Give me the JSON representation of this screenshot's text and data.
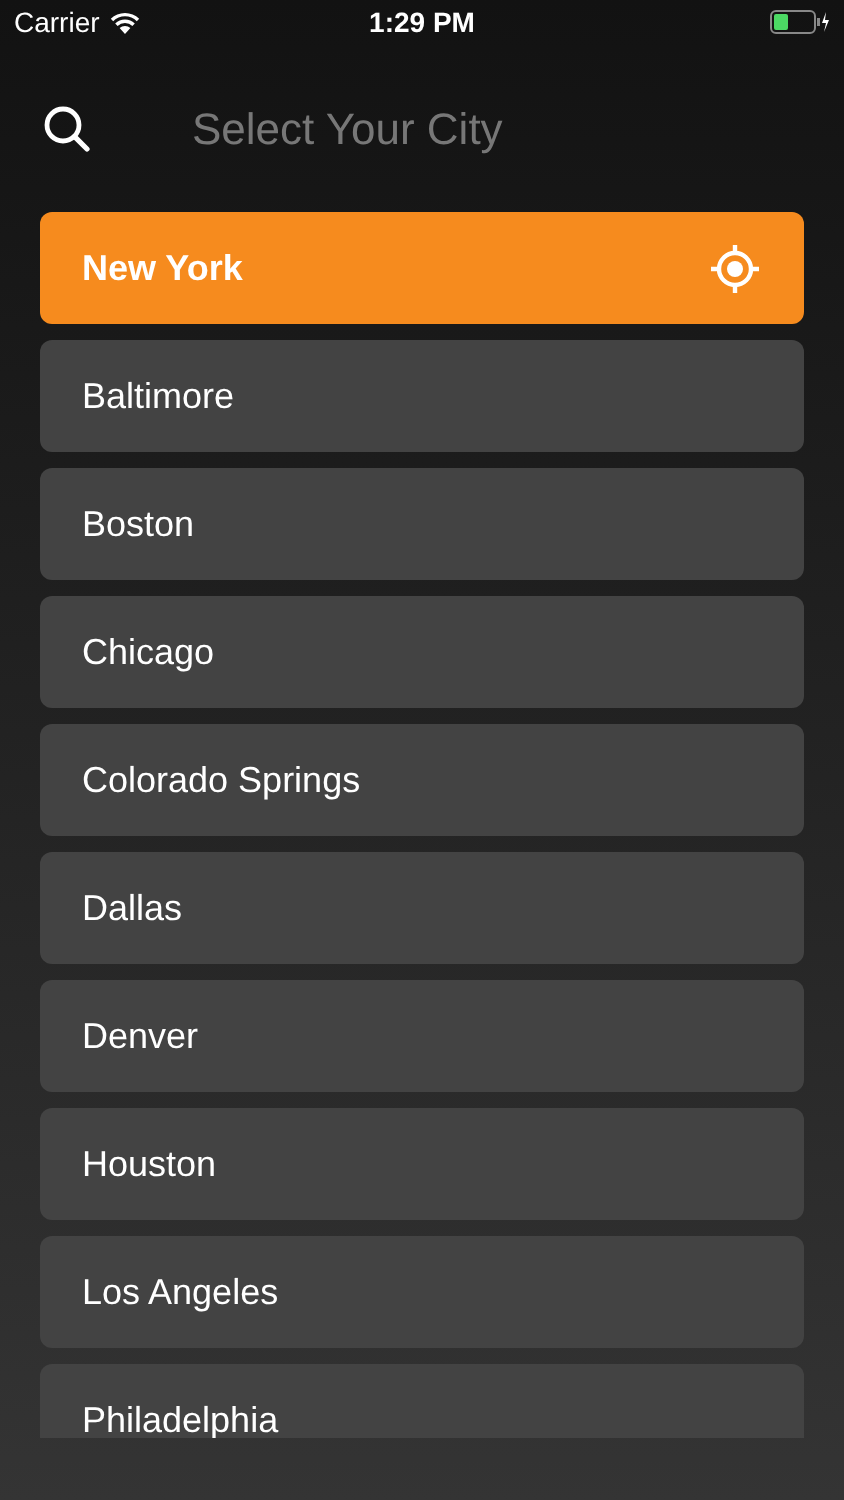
{
  "status_bar": {
    "carrier": "Carrier",
    "time": "1:29 PM"
  },
  "search": {
    "placeholder": "Select Your City"
  },
  "cities": [
    {
      "name": "New York",
      "selected": true
    },
    {
      "name": "Baltimore",
      "selected": false
    },
    {
      "name": "Boston",
      "selected": false
    },
    {
      "name": "Chicago",
      "selected": false
    },
    {
      "name": "Colorado Springs",
      "selected": false
    },
    {
      "name": "Dallas",
      "selected": false
    },
    {
      "name": "Denver",
      "selected": false
    },
    {
      "name": "Houston",
      "selected": false
    },
    {
      "name": "Los Angeles",
      "selected": false
    },
    {
      "name": "Philadelphia",
      "selected": false
    }
  ]
}
